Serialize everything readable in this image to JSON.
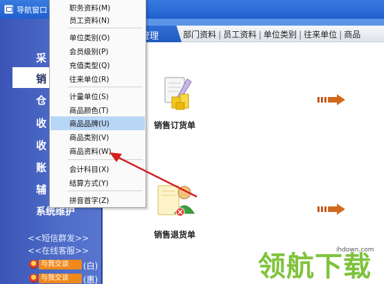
{
  "window": {
    "title": "导航窗口"
  },
  "left_nav": {
    "items": [
      {
        "label": "采"
      },
      {
        "label": "销"
      },
      {
        "label": "仓"
      },
      {
        "label": "收"
      },
      {
        "label": "收"
      },
      {
        "label": "账"
      },
      {
        "label": "辅"
      },
      {
        "label": "系统维护"
      }
    ],
    "links": {
      "sms": "<<短信群发>>",
      "service": "<<在线客服>>"
    },
    "qq": [
      {
        "button": "与我交谈",
        "suffix": "(白)"
      },
      {
        "button": "与我交谈",
        "suffix": "(惠)"
      }
    ]
  },
  "tabs": {
    "active": "管理",
    "links": [
      "部门资料",
      "员工资料",
      "单位类别",
      "往来单位",
      "商品"
    ]
  },
  "menu": {
    "items": [
      {
        "label": "职务资料(M)"
      },
      {
        "label": "员工资料(N)"
      },
      {
        "label": "单位类别(O)"
      },
      {
        "label": "会员级别(P)"
      },
      {
        "label": "充值类型(Q)"
      },
      {
        "label": "往来单位(R)"
      },
      {
        "label": "计量单位(S)"
      },
      {
        "label": "商品颜色(T)"
      },
      {
        "label": "商品品牌(U)"
      },
      {
        "label": "商品类别(V)"
      },
      {
        "label": "商品资料(W)"
      },
      {
        "label": "会计科目(X)"
      },
      {
        "label": "结算方式(Y)"
      },
      {
        "label": "拼音首字(Z)"
      }
    ],
    "highlighted_index": 8
  },
  "modules": [
    {
      "label": "销售订货单"
    },
    {
      "label": "销售退货单"
    }
  ],
  "watermark": {
    "text": "领航下载",
    "url": "ihdown.com"
  },
  "colors": {
    "title_bar": "#2a6ad8",
    "left_nav": "#4560c0",
    "menu_highlight": "#b8d6f6",
    "arrow": "#d2691e",
    "pointer": "#d42020",
    "watermark": "#7fc33c"
  }
}
